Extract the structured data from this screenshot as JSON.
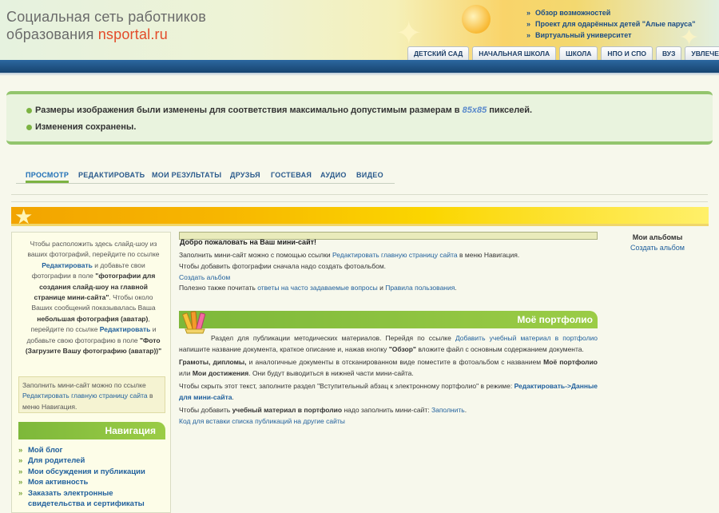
{
  "site": {
    "title_line1": "Социальная сеть работников",
    "title_line2_prefix": "образования ",
    "brand": "nsportal.ru"
  },
  "top_links": [
    "Обзор возможностей",
    "Проект для одарённых детей \"Алые паруса\"",
    "Виртуальный университет"
  ],
  "grade_tabs": [
    "ДЕТСКИЙ САД",
    "НАЧАЛЬНАЯ ШКОЛА",
    "ШКОЛА",
    "НПО И СПО",
    "ВУЗ",
    "УВЛЕЧЕНИЯ"
  ],
  "messages": {
    "resize_prefix": "Размеры изображения были изменены для соответствия максимально допустимым размерам в ",
    "resize_size": "85x85",
    "resize_suffix": " пикселей.",
    "saved": "Изменения сохранены."
  },
  "tabs": [
    "ПРОСМОТР",
    "РЕДАКТИРОВАТЬ",
    "МОИ РЕЗУЛЬТАТЫ",
    "ДРУЗЬЯ",
    "ГОСТЕВАЯ",
    "АУДИО",
    "ВИДЕО"
  ],
  "active_tab": "ПРОСМОТР",
  "sidebar": {
    "slideshow_1": "Чтобы расположить здесь слайд-шоу из ваших фотографий, перейдите по ссылке ",
    "slideshow_link1": "Редактировать",
    "slideshow_2": " и добавьте свои фотографии в поле ",
    "slideshow_bold1": "\"фотографии для создания слайд-шоу на главной странице мини-сайта\"",
    "slideshow_3": ". Чтобы около Ваших сообщений показывалась Ваша ",
    "slideshow_bold2": "небольшая фотография (аватар)",
    "slideshow_4": ", перейдите по ссылке ",
    "slideshow_link2": "Редактировать",
    "slideshow_5": " и добавьте свою фотографию в поле ",
    "slideshow_bold3": "\"Фото (Загрузите Вашу фотографию (аватар))\"",
    "fill_prefix": "Заполнить мини-сайт можно по ссылке ",
    "fill_link": "Редактировать главную страницу сайта",
    "fill_suffix": " в меню Навигация.",
    "nav_title": "Навигация",
    "nav_items": [
      "Мой блог",
      "Для родителей",
      "Мои обсуждения и публикации",
      "Моя активность",
      "Заказать электронные свидетельства и сертификаты"
    ]
  },
  "main": {
    "welcome": "Добро пожаловать на Ваш мини-сайт!",
    "fill_prefix": "Заполнить мини-сайт можно с помощью ссылки ",
    "fill_link": "Редактировать главную страницу сайта",
    "fill_suffix": " в меню Навигация.",
    "photo_hint": "Чтобы добавить фотографии сначала надо создать фотоальбом.",
    "create_album": "Создать альбом",
    "read_prefix": "Полезно также почитать ",
    "faq_link": "ответы на часто задаваемые вопросы",
    "read_and": " и ",
    "rules_link": "Правила пользования",
    "read_suffix": "."
  },
  "portfolio": {
    "title": "Моё портфолио",
    "p1_prefix": "Раздел для публикации методических материалов. Перейдя по ссылке ",
    "p1_link": "Добавить учебный материал в портфолио",
    "p1_mid": " напишите название документа, краткое описание и, нажав кнопку ",
    "p1_bold": "\"Обзор\"",
    "p1_suffix": " вложите файл с основным содержанием документа.",
    "p2_bold1": "Грамоты, дипломы,",
    "p2_mid1": " и аналогичные документы в отсканированном виде поместите в фотоальбом с названием ",
    "p2_bold2": "Моё портфолио",
    "p2_mid2": " или ",
    "p2_bold3": "Мои достижения",
    "p2_suffix": ". Они будут выводиться в нижней части мини-сайта.",
    "p3_prefix": "Чтобы скрыть этот текст, заполните раздел \"Вступительный абзац к электронному портфолио\" в режиме: ",
    "p3_link": "Редактировать->Данные для мини-сайта",
    "p3_suffix": ".",
    "p4_prefix": "Чтобы добавить ",
    "p4_bold": "учебный материал в портфолио",
    "p4_mid": " надо заполнить мини-сайт: ",
    "p4_link": "Заполнить",
    "p4_suffix": ".",
    "code_link": "Код для вставки списка публикаций на другие сайты"
  },
  "albums": {
    "title": "Мои альбомы",
    "create": "Создать альбом"
  },
  "colors": {
    "nav_blue": "#1f5f9c",
    "green_header": "#7db83a",
    "banner_orange": "#f7b600",
    "brand_red": "#e34b2a"
  }
}
